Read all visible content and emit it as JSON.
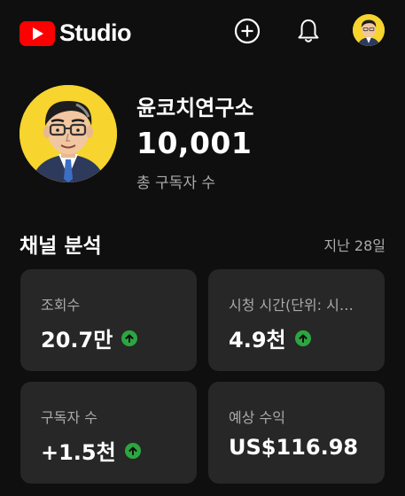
{
  "app": {
    "logo_text": "Studio",
    "icons": [
      "create-icon",
      "notifications-icon",
      "account-avatar"
    ],
    "colors": {
      "brand_red": "#ff0000",
      "background": "#0f0f0f",
      "card": "#272727",
      "trend_up": "#2ba640",
      "avatar_bg": "#f7d42e"
    }
  },
  "channel": {
    "name": "윤코치연구소",
    "subscribers": "10,001",
    "subscribers_label": "총 구독자 수"
  },
  "analytics": {
    "title": "채널 분석",
    "period": "지난 28일",
    "cards": [
      {
        "label": "조회수",
        "value": "20.7만",
        "trend": "up"
      },
      {
        "label": "시청 시간(단위: 시…",
        "value": "4.9천",
        "trend": "up"
      },
      {
        "label": "구독자 수",
        "value": "+1.5천",
        "trend": "up"
      },
      {
        "label": "예상 수익",
        "value": "US$116.98",
        "trend": "none"
      }
    ]
  }
}
